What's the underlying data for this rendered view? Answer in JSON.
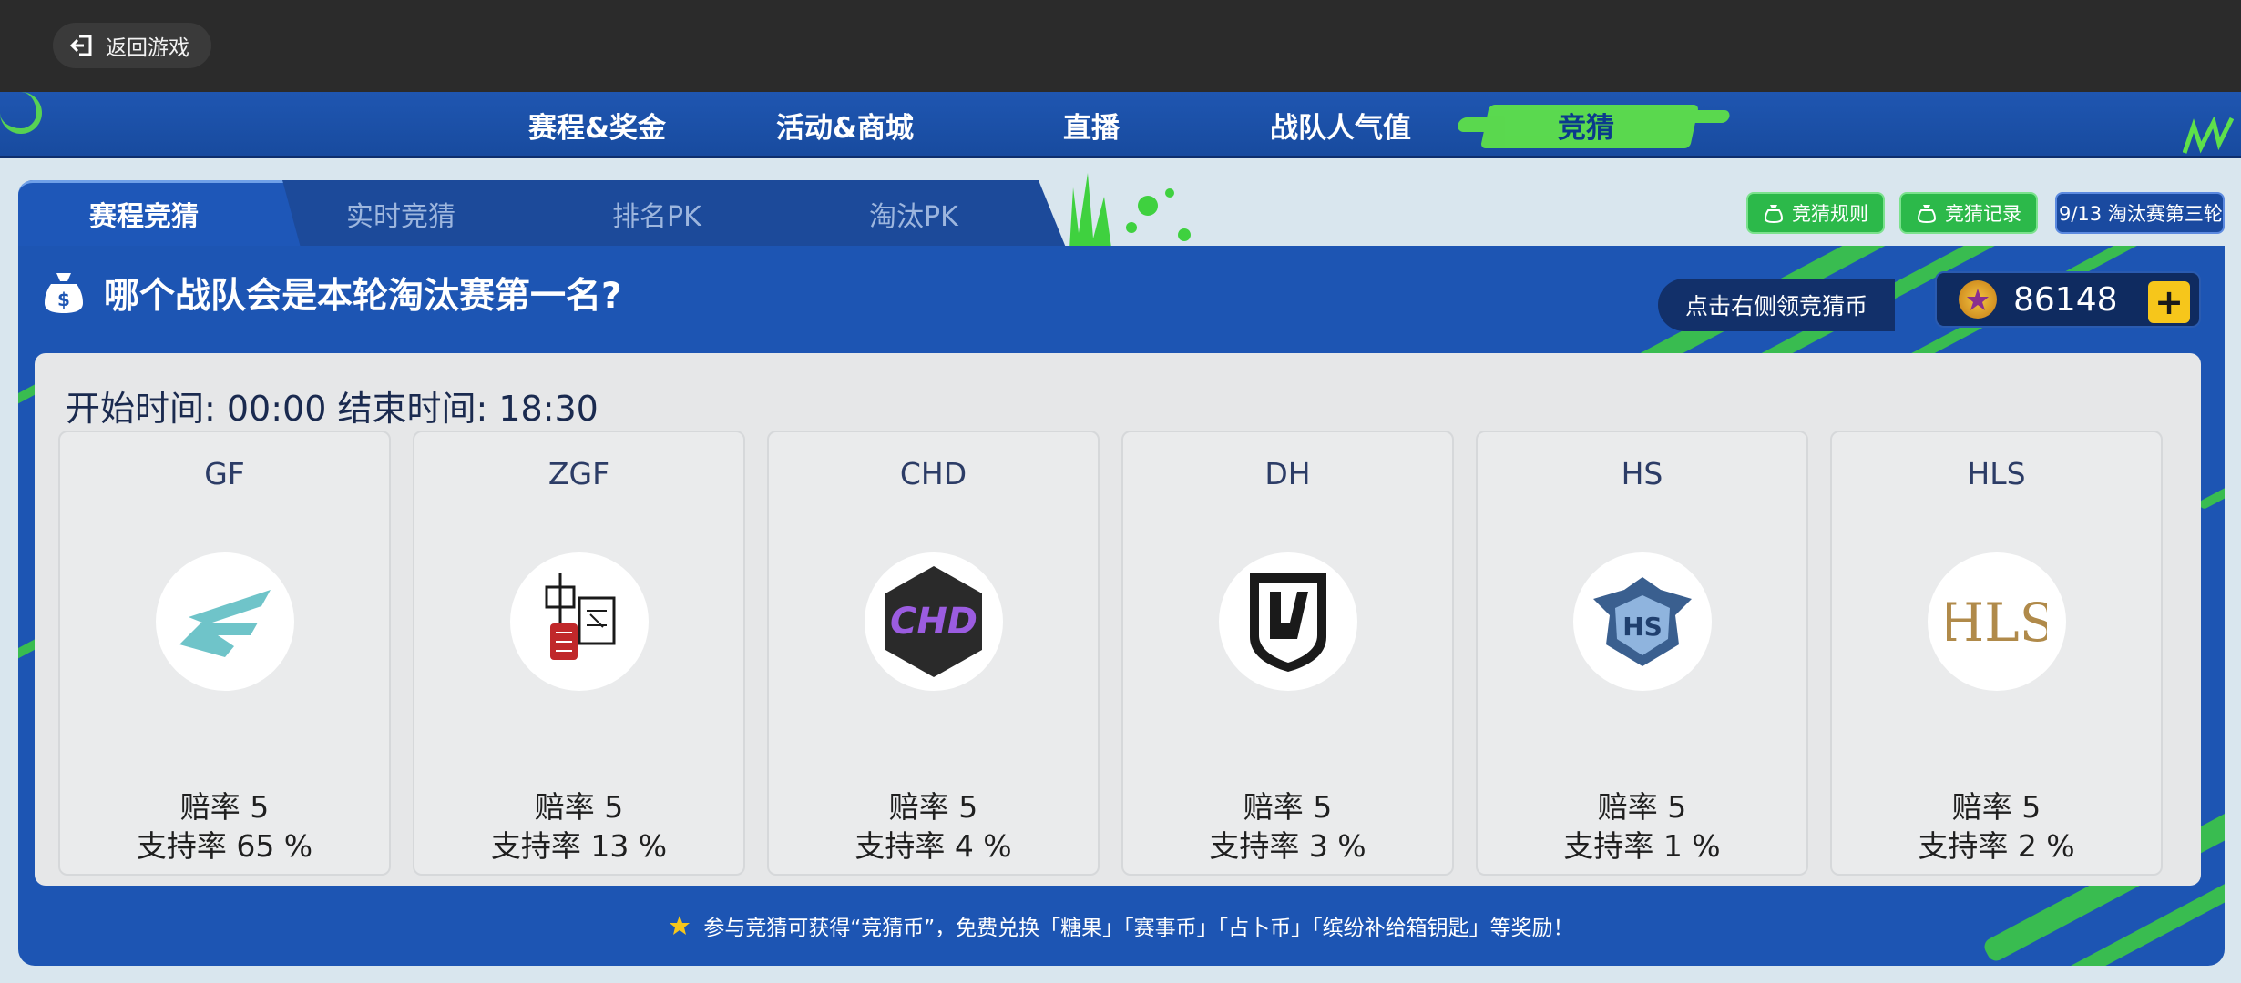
{
  "topbar": {
    "back_label": "返回游戏"
  },
  "nav": {
    "items": [
      {
        "label": "赛程&奖金"
      },
      {
        "label": "活动&商城"
      },
      {
        "label": "直播"
      },
      {
        "label": "战队人气值"
      },
      {
        "label": "竞猜",
        "active": true
      }
    ],
    "active_color": "#5ee04a"
  },
  "tabs": [
    {
      "label": "赛程竞猜",
      "active": true
    },
    {
      "label": "实时竞猜"
    },
    {
      "label": "排名PK"
    },
    {
      "label": "淘汰PK"
    }
  ],
  "actions": {
    "rules_label": "竞猜规则",
    "records_label": "竞猜记录",
    "stage_label": "9/13 淘汰赛第三轮"
  },
  "question": {
    "text": "哪个战队会是本轮淘汰赛第一名?"
  },
  "coins": {
    "claim_hint": "点击右侧领竞猜币",
    "balance": "86148",
    "add_label": "+"
  },
  "schedule": {
    "time_text": "开始时间: 00:00 结束时间: 18:30"
  },
  "teams": [
    {
      "name": "GF",
      "odds": "赔率 5",
      "support": "支持率 65 %",
      "logo": "gf-logo"
    },
    {
      "name": "ZGF",
      "odds": "赔率 5",
      "support": "支持率 13 %",
      "logo": "zgf-logo"
    },
    {
      "name": "CHD",
      "odds": "赔率 5",
      "support": "支持率 4 %",
      "logo": "chd-logo"
    },
    {
      "name": "DH",
      "odds": "赔率 5",
      "support": "支持率 3 %",
      "logo": "dh-logo"
    },
    {
      "name": "HS",
      "odds": "赔率 5",
      "support": "支持率 1 %",
      "logo": "hs-logo"
    },
    {
      "name": "HLS",
      "odds": "赔率 5",
      "support": "支持率 2 %",
      "logo": "hls-logo"
    }
  ],
  "footer": {
    "note": "参与竞猜可获得“竞猜币”，免费兑换「糖果」「赛事币」「占卜币」「缤纷补给箱钥匙」等奖励！"
  },
  "colors": {
    "brand_blue": "#1d55b3",
    "accent_green": "#5ee04a",
    "coin_gold": "#f6c61b"
  }
}
